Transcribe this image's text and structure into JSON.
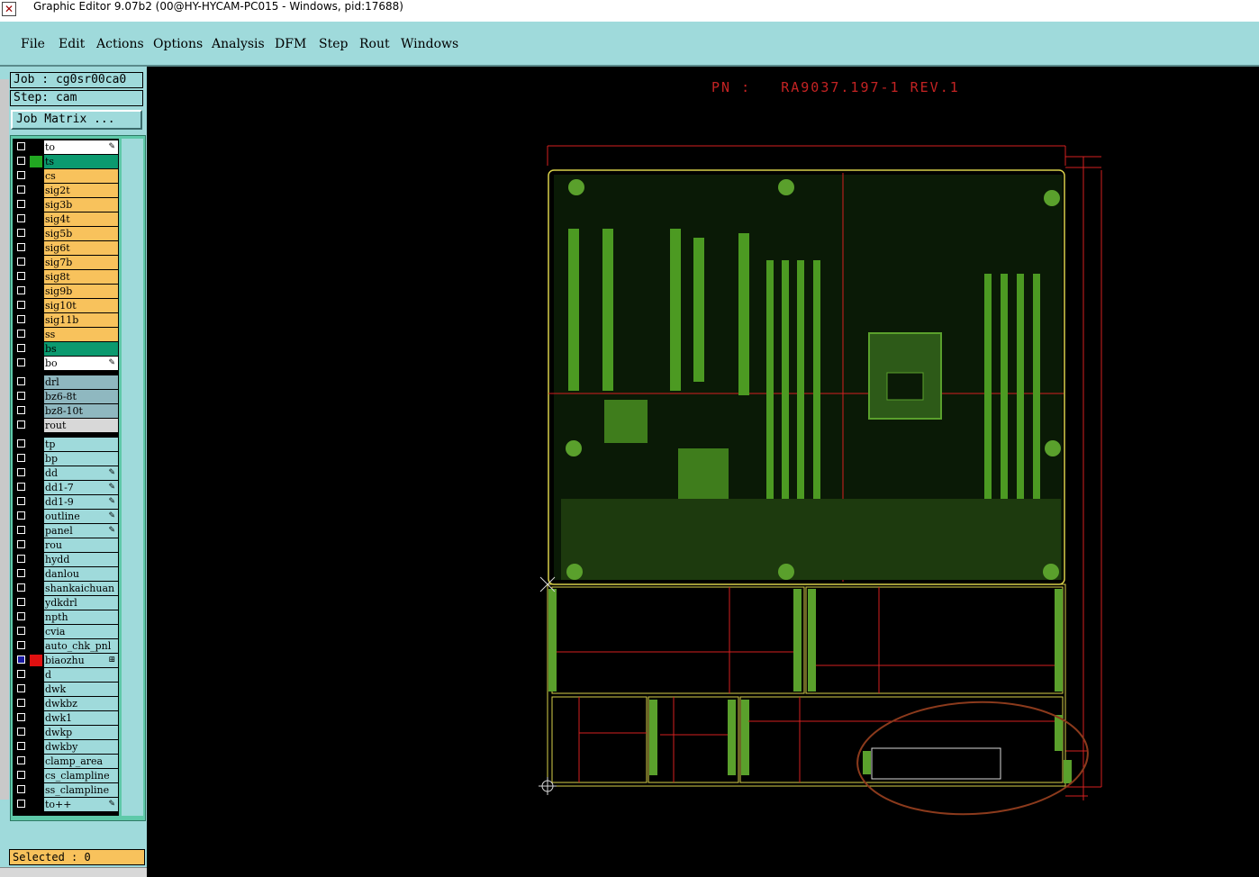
{
  "window": {
    "title": "Graphic Editor 9.07b2 (00@HY-HYCAM-PC015 - Windows, pid:17688)",
    "icon": "app-icon"
  },
  "menu": {
    "items": [
      "File",
      "Edit",
      "Actions",
      "Options",
      "Analysis",
      "DFM",
      "Step",
      "Rout",
      "Windows"
    ]
  },
  "info": {
    "job": "Job : cg0sr00ca0",
    "step": "Step: cam",
    "job_matrix": "Job Matrix ..."
  },
  "layers": [
    {
      "name": "to",
      "color": "#ffffff",
      "marker": "#000000",
      "flag": "pen-icon"
    },
    {
      "name": "ts",
      "color": "#0b9a6f",
      "marker": "#22a822",
      "flag": ""
    },
    {
      "name": "cs",
      "color": "#f8c25c",
      "marker": "#000000",
      "flag": ""
    },
    {
      "name": "sig2t",
      "color": "#f8c25c",
      "marker": "#000000",
      "flag": ""
    },
    {
      "name": "sig3b",
      "color": "#f8c25c",
      "marker": "#000000",
      "flag": ""
    },
    {
      "name": "sig4t",
      "color": "#f8c25c",
      "marker": "#000000",
      "flag": ""
    },
    {
      "name": "sig5b",
      "color": "#f8c25c",
      "marker": "#000000",
      "flag": ""
    },
    {
      "name": "sig6t",
      "color": "#f8c25c",
      "marker": "#000000",
      "flag": ""
    },
    {
      "name": "sig7b",
      "color": "#f8c25c",
      "marker": "#000000",
      "flag": ""
    },
    {
      "name": "sig8t",
      "color": "#f8c25c",
      "marker": "#000000",
      "flag": ""
    },
    {
      "name": "sig9b",
      "color": "#f8c25c",
      "marker": "#000000",
      "flag": ""
    },
    {
      "name": "sig10t",
      "color": "#f8c25c",
      "marker": "#000000",
      "flag": ""
    },
    {
      "name": "sig11b",
      "color": "#f8c25c",
      "marker": "#000000",
      "flag": ""
    },
    {
      "name": "ss",
      "color": "#f8c25c",
      "marker": "#000000",
      "flag": ""
    },
    {
      "name": "bs",
      "color": "#0b9a6f",
      "marker": "#000000",
      "flag": ""
    },
    {
      "name": "bo",
      "color": "#ffffff",
      "marker": "#000000",
      "flag": "pen-icon"
    },
    {
      "name": "drl",
      "color": "#8fb8c0",
      "marker": "#000000",
      "flag": ""
    },
    {
      "name": "bz6-8t",
      "color": "#8fb8c0",
      "marker": "#000000",
      "flag": ""
    },
    {
      "name": "bz8-10t",
      "color": "#8fb8c0",
      "marker": "#000000",
      "flag": ""
    },
    {
      "name": "rout",
      "color": "#d8d8d8",
      "marker": "#000000",
      "flag": ""
    },
    {
      "name": "tp",
      "color": "#9fdadb",
      "marker": "#000000",
      "flag": ""
    },
    {
      "name": "bp",
      "color": "#9fdadb",
      "marker": "#000000",
      "flag": ""
    },
    {
      "name": "dd",
      "color": "#9fdadb",
      "marker": "#000000",
      "flag": "pen-icon"
    },
    {
      "name": "dd1-7",
      "color": "#9fdadb",
      "marker": "#000000",
      "flag": "pen-icon"
    },
    {
      "name": "dd1-9",
      "color": "#9fdadb",
      "marker": "#000000",
      "flag": "pen-icon"
    },
    {
      "name": "outline",
      "color": "#9fdadb",
      "marker": "#000000",
      "flag": "pen-icon"
    },
    {
      "name": "panel",
      "color": "#9fdadb",
      "marker": "#000000",
      "flag": "pen-icon"
    },
    {
      "name": "rou",
      "color": "#9fdadb",
      "marker": "#000000",
      "flag": ""
    },
    {
      "name": "hydd",
      "color": "#9fdadb",
      "marker": "#000000",
      "flag": ""
    },
    {
      "name": "danlou",
      "color": "#9fdadb",
      "marker": "#000000",
      "flag": ""
    },
    {
      "name": "shankaichuan",
      "color": "#9fdadb",
      "marker": "#000000",
      "flag": ""
    },
    {
      "name": "ydkdrl",
      "color": "#9fdadb",
      "marker": "#000000",
      "flag": ""
    },
    {
      "name": "npth",
      "color": "#9fdadb",
      "marker": "#000000",
      "flag": ""
    },
    {
      "name": "cvia",
      "color": "#9fdadb",
      "marker": "#000000",
      "flag": ""
    },
    {
      "name": "auto_chk_pnl",
      "color": "#9fdadb",
      "marker": "#000000",
      "flag": ""
    },
    {
      "name": "biaozhu",
      "color": "#9fdadb",
      "marker": "#e01010",
      "flag": "grid-icon",
      "checked": true
    },
    {
      "name": "d",
      "color": "#9fdadb",
      "marker": "#000000",
      "flag": ""
    },
    {
      "name": "dwk",
      "color": "#9fdadb",
      "marker": "#000000",
      "flag": ""
    },
    {
      "name": "dwkbz",
      "color": "#9fdadb",
      "marker": "#000000",
      "flag": ""
    },
    {
      "name": "dwk1",
      "color": "#9fdadb",
      "marker": "#000000",
      "flag": ""
    },
    {
      "name": "dwkp",
      "color": "#9fdadb",
      "marker": "#000000",
      "flag": ""
    },
    {
      "name": "dwkby",
      "color": "#9fdadb",
      "marker": "#000000",
      "flag": ""
    },
    {
      "name": "clamp_area",
      "color": "#9fdadb",
      "marker": "#000000",
      "flag": ""
    },
    {
      "name": "cs_clampline",
      "color": "#9fdadb",
      "marker": "#000000",
      "flag": ""
    },
    {
      "name": "ss_clampline",
      "color": "#9fdadb",
      "marker": "#000000",
      "flag": ""
    },
    {
      "name": "to++",
      "color": "#9fdadb",
      "marker": "#000000",
      "flag": "pen-icon"
    }
  ],
  "status": {
    "selected": "Selected : 0"
  },
  "canvas": {
    "part_number": "PN :   RA9037.197-1 REV.1",
    "colors": {
      "background": "#000000",
      "copper": "#5aa02c",
      "dimension": "#d42020",
      "outline": "#d8d04a",
      "annotation": "#8b3a1c"
    }
  }
}
